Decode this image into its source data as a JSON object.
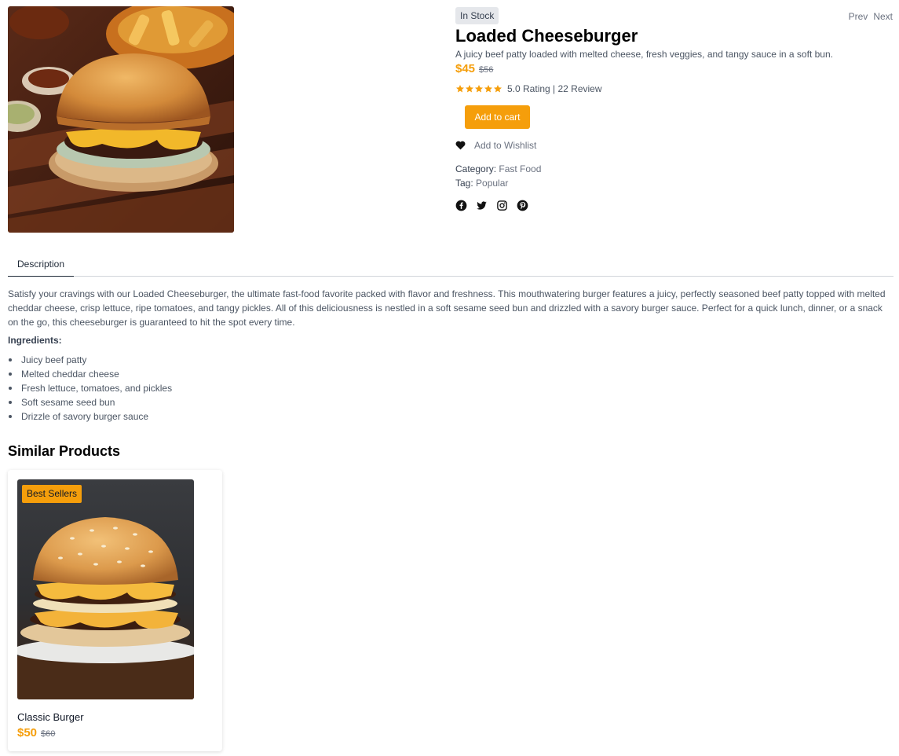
{
  "product": {
    "image_icon": "loaded-cheeseburger-photo",
    "stock_status": "In Stock",
    "nav": {
      "prev": "Prev",
      "next": "Next"
    },
    "title": "Loaded Cheeseburger",
    "subtitle": "A juicy beef patty loaded with melted cheese, fresh veggies, and tangy sauce in a soft bun.",
    "price": "$45",
    "old_price": "$56",
    "stars": 5,
    "rating_text": "5.0 Rating | 22 Review",
    "add_to_cart_label": "Add to cart",
    "wishlist_label": "Add to Wishlist",
    "category_label": "Category:",
    "category_value": "Fast Food",
    "tag_label": "Tag:",
    "tag_value": "Popular",
    "social_icons": [
      "facebook-icon",
      "twitter-icon",
      "instagram-icon",
      "pinterest-icon"
    ]
  },
  "tabs": {
    "description_label": "Description"
  },
  "description": {
    "text": "Satisfy your cravings with our Loaded Cheeseburger, the ultimate fast-food favorite packed with flavor and freshness. This mouthwatering burger features a juicy, perfectly seasoned beef patty topped with melted cheddar cheese, crisp lettuce, ripe tomatoes, and tangy pickles. All of this deliciousness is nestled in a soft sesame seed bun and drizzled with a savory burger sauce. Perfect for a quick lunch, dinner, or a snack on the go, this cheeseburger is guaranteed to hit the spot every time.",
    "ingredients_heading": "Ingredients:",
    "ingredients": [
      "Juicy beef patty",
      "Melted cheddar cheese",
      "Fresh lettuce, tomatoes, and pickles",
      "Soft sesame seed bun",
      "Drizzle of savory burger sauce"
    ]
  },
  "similar": {
    "heading": "Similar Products",
    "items": [
      {
        "badge": "Best Sellers",
        "title": "Classic Burger",
        "price": "$50",
        "old_price": "$60",
        "image_icon": "classic-burger-photo"
      }
    ]
  },
  "colors": {
    "accent": "#f59e0b",
    "text": "#4b5563",
    "heading": "#000000",
    "badge_bg": "#e5e7eb"
  }
}
